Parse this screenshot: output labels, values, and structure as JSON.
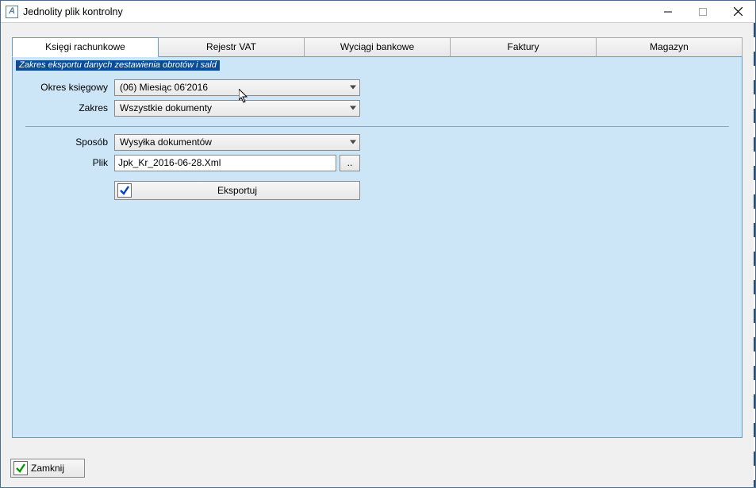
{
  "window": {
    "title": "Jednolity plik kontrolny",
    "icon_letter": "A"
  },
  "tabs": [
    {
      "label": "Księgi rachunkowe",
      "active": true
    },
    {
      "label": "Rejestr VAT",
      "active": false
    },
    {
      "label": "Wyciągi bankowe",
      "active": false
    },
    {
      "label": "Faktury",
      "active": false
    },
    {
      "label": "Magazyn",
      "active": false
    }
  ],
  "section_title": "Zakres eksportu danych zestawienia obrotów i sald",
  "labels": {
    "okres": "Okres księgowy",
    "zakres": "Zakres",
    "sposob": "Sposób",
    "plik": "Plik"
  },
  "fields": {
    "okres": "(06) Miesiąc 06'2016",
    "zakres": "Wszystkie dokumenty",
    "sposob": "Wysyłka dokumentów",
    "plik": "Jpk_Kr_2016-06-28.Xml",
    "browse": ".."
  },
  "buttons": {
    "export": "Eksportuj",
    "close": "Zamknij"
  }
}
